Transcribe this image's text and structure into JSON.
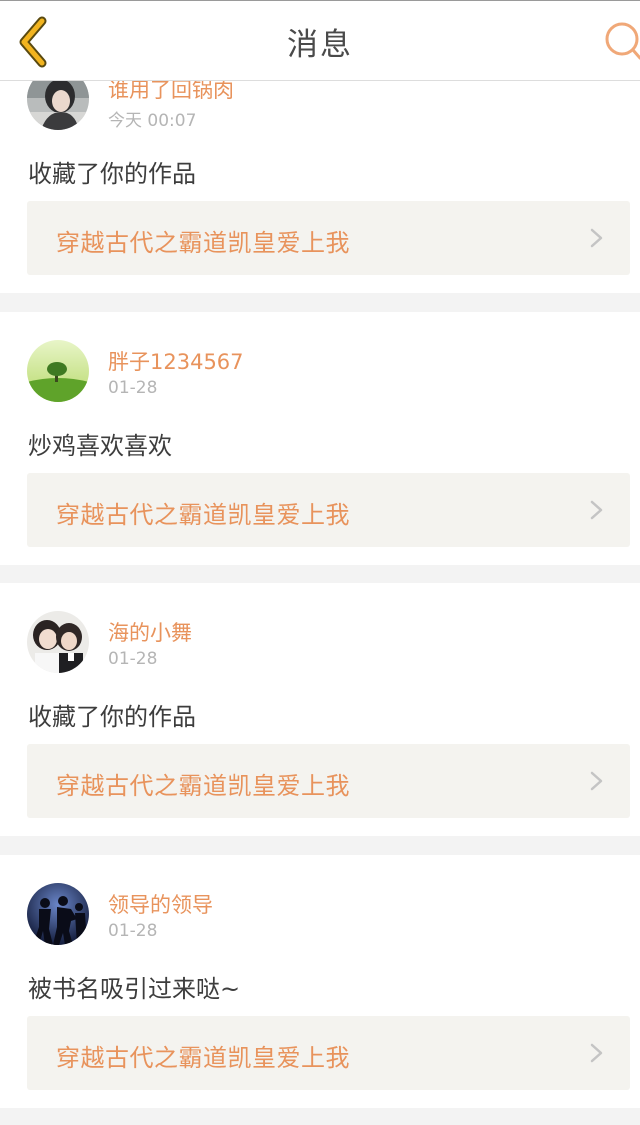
{
  "header": {
    "title": "消息"
  },
  "messages": [
    {
      "username": "谁用了回锅肉",
      "time": "今天 00:07",
      "text": "收藏了你的作品",
      "work_title": "穿越古代之霸道凯皇爱上我",
      "avatar": "avatar-girl-photo"
    },
    {
      "username": "胖子1234567",
      "time": "01-28",
      "text": "炒鸡喜欢喜欢",
      "work_title": "穿越古代之霸道凯皇爱上我",
      "avatar": "avatar-tree-landscape"
    },
    {
      "username": "海的小舞",
      "time": "01-28",
      "text": "收藏了你的作品",
      "work_title": "穿越古代之霸道凯皇爱上我",
      "avatar": "avatar-two-dolls"
    },
    {
      "username": "领导的领导",
      "time": "01-28",
      "text": "被书名吸引过来哒~",
      "work_title": "穿越古代之霸道凯皇爱上我",
      "avatar": "avatar-silhouettes-blue"
    }
  ],
  "colors": {
    "accent": "#e8935c",
    "back_icon": "#f2b41f",
    "search_icon": "#f0a878",
    "link_background": "#f4f3ef",
    "page_background": "#f3f3f3"
  }
}
